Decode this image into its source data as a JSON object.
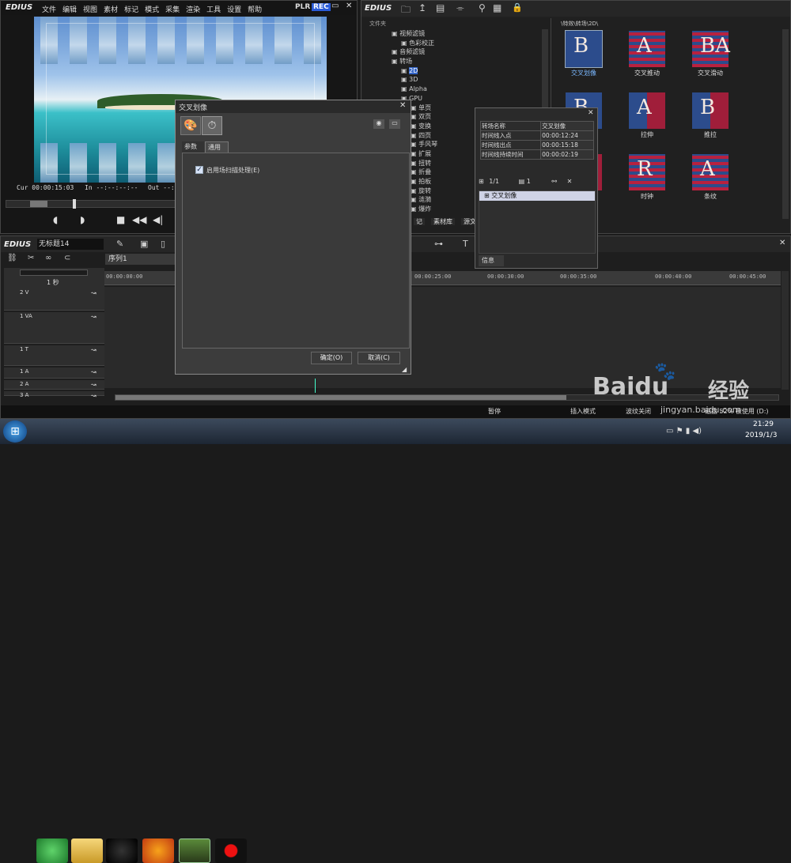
{
  "player": {
    "logo": "EDIUS",
    "menu": [
      "文件",
      "编辑",
      "视图",
      "素材",
      "标记",
      "模式",
      "采集",
      "渲染",
      "工具",
      "设置",
      "帮助"
    ],
    "plr": "PLR",
    "rec": "REC",
    "cur_label": "Cur",
    "cur": "00:00:15:03",
    "in_label": "In",
    "in": "--:--:--:--",
    "out_label": "Out",
    "out": "--:--:--:--"
  },
  "bin": {
    "logo": "EDIUS",
    "folder_label": "文件夹",
    "path": "\\特效\\转场\\2D\\",
    "tree": [
      "视频滤镜",
      "色彩校正",
      "音频滤镜",
      "转场",
      "2D",
      "3D",
      "Alpha",
      "GPU",
      "单页",
      "双页",
      "变换",
      "四页",
      "手风琴",
      "扩展",
      "扭转",
      "折叠",
      "拍板",
      "旋转",
      "涟漪",
      "爆炸"
    ],
    "tabs": [
      "记",
      "素材库",
      "源文件"
    ],
    "effects": [
      "交叉划像",
      "交叉推动",
      "交叉滑动",
      "",
      "拉伸",
      "推拉",
      "",
      "时钟",
      "条纹"
    ]
  },
  "dialog": {
    "title": "交叉划像",
    "tabs": [
      "参数",
      "通用"
    ],
    "checkbox": "启用场扫描处理(E)",
    "ok": "确定(O)",
    "cancel": "取消(C)"
  },
  "info": {
    "rows": [
      [
        "转场名称",
        "交叉划像"
      ],
      [
        "时间线入点",
        "00:00:12:24"
      ],
      [
        "时间线出点",
        "00:00:15:18"
      ],
      [
        "时间线持续时间",
        "00:00:02:19"
      ]
    ],
    "page": "1/1",
    "count": "1",
    "item": "交叉划像",
    "tab": "信息"
  },
  "timeline": {
    "logo": "EDIUS",
    "project": "无标题14",
    "seq": "序列1",
    "zoom": "1 秒",
    "tracks": [
      "2 V",
      "1 VA",
      "1 T",
      "1 A",
      "2 A",
      "3 A"
    ],
    "ticks": [
      "00:00:00:00",
      "00:00:25:00",
      "00:00:30:00",
      "00:00:35:00",
      "00:00:40:00",
      "00:00:45:00"
    ]
  },
  "status": {
    "items": [
      "暂停",
      "插入模式",
      "波纹关闭",
      "磁盘 52% 被使用 (D:)"
    ]
  },
  "taskbar": {
    "time": "21:29",
    "date": "2019/1/3"
  },
  "watermark": {
    "brand": "Baidu",
    "text": "经验",
    "url": "jingyan.baidu.com"
  }
}
